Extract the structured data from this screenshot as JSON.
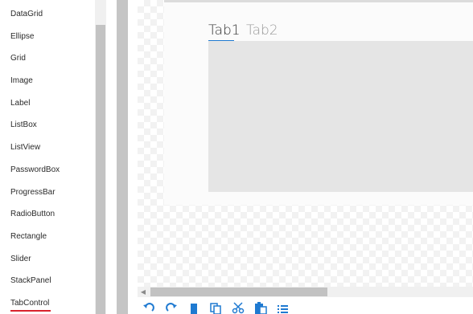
{
  "toolbox": {
    "items": [
      {
        "label": "DataGrid"
      },
      {
        "label": "Ellipse"
      },
      {
        "label": "Grid"
      },
      {
        "label": "Image"
      },
      {
        "label": "Label"
      },
      {
        "label": "ListBox"
      },
      {
        "label": "ListView"
      },
      {
        "label": "PasswordBox"
      },
      {
        "label": "ProgressBar"
      },
      {
        "label": "RadioButton"
      },
      {
        "label": "Rectangle"
      },
      {
        "label": "Slider"
      },
      {
        "label": "StackPanel"
      },
      {
        "label": "TabControl",
        "selected": true
      }
    ]
  },
  "designer": {
    "tabs": [
      {
        "label": "Tab1",
        "selected": true
      },
      {
        "label": "Tab2",
        "selected": false
      }
    ]
  },
  "toolbar": {
    "buttons": [
      {
        "icon": "undo-icon"
      },
      {
        "icon": "redo-icon"
      },
      {
        "icon": "delete-icon"
      },
      {
        "icon": "copy-icon"
      },
      {
        "icon": "cut-icon"
      },
      {
        "icon": "paste-icon"
      },
      {
        "icon": "list-icon"
      }
    ]
  },
  "colors": {
    "accent": "#1f7ad1",
    "selection_underline": "#d9232d",
    "tab_content_bg": "#e5e5e5"
  }
}
